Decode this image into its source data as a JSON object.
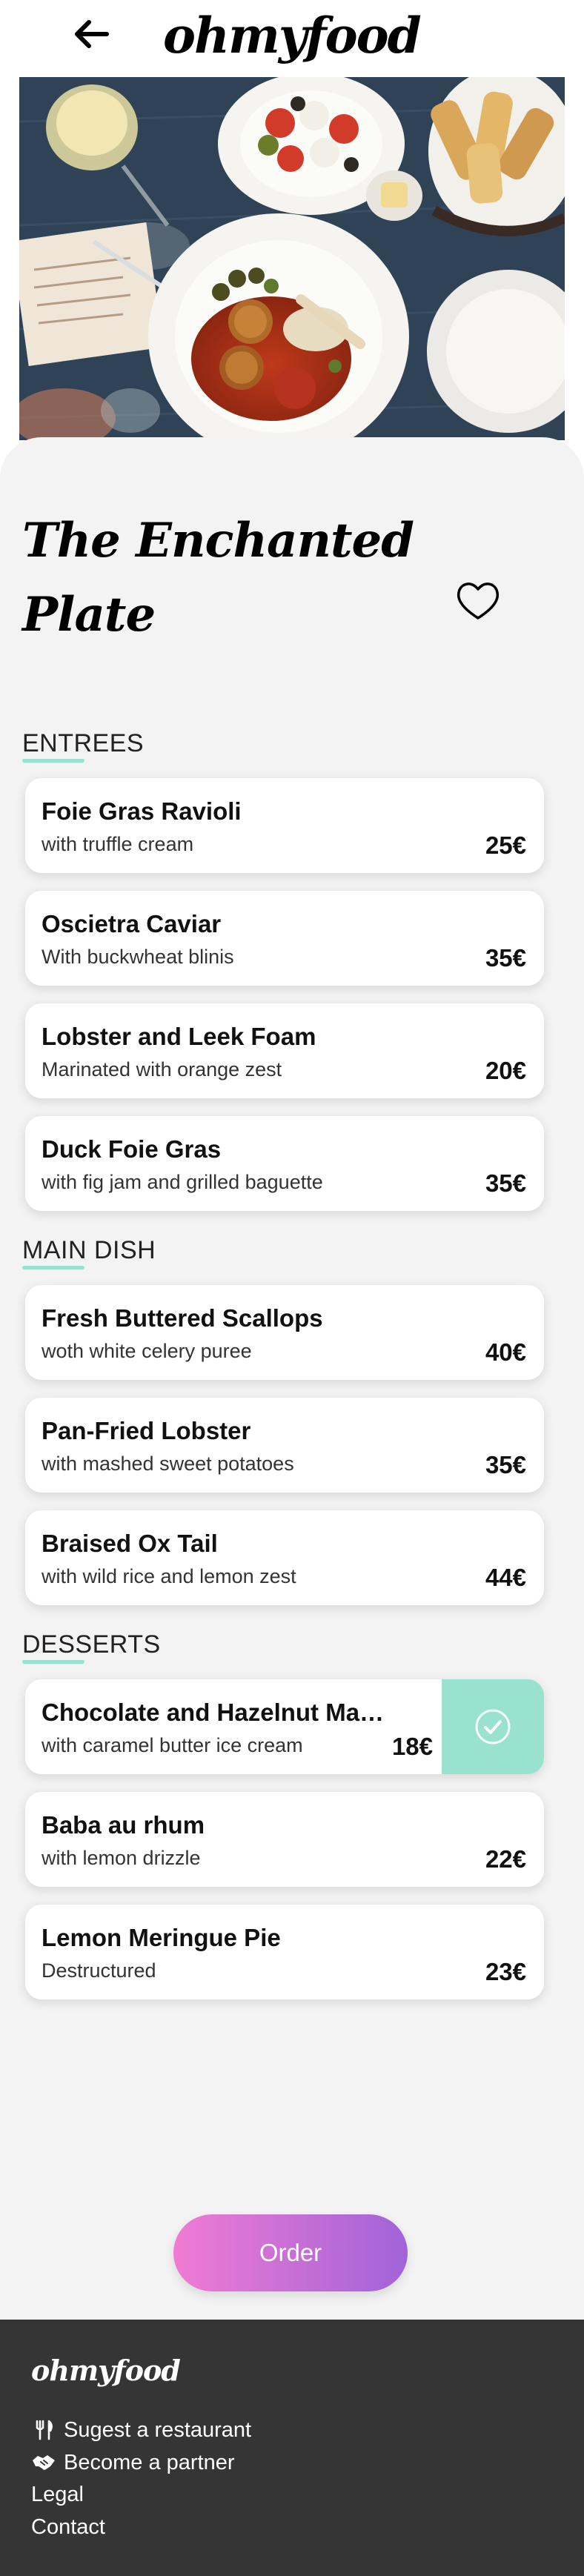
{
  "header": {
    "logo": "ohmyfood"
  },
  "restaurant": {
    "name": "The Enchanted Plate"
  },
  "sections": [
    {
      "title": "ENTREES",
      "dishes": [
        {
          "name": "Foie Gras Ravioli",
          "desc": "with truffle cream",
          "price": "25€"
        },
        {
          "name": "Oscietra Caviar",
          "desc": "With buckwheat blinis",
          "price": "35€"
        },
        {
          "name": "Lobster and Leek Foam",
          "desc": "Marinated with orange zest",
          "price": "20€"
        },
        {
          "name": "Duck Foie Gras",
          "desc": "with fig jam and grilled baguette",
          "price": "35€"
        }
      ]
    },
    {
      "title": "MAIN DISH",
      "dishes": [
        {
          "name": "Fresh Buttered Scallops",
          "desc": "woth white celery puree",
          "price": "40€"
        },
        {
          "name": "Pan-Fried Lobster",
          "desc": "with mashed sweet potatoes",
          "price": "35€"
        },
        {
          "name": "Braised Ox Tail",
          "desc": "with wild rice and lemon zest",
          "price": "44€"
        }
      ]
    },
    {
      "title": "DESSERTS",
      "dishes": [
        {
          "name": "Chocolate and Hazelnut Ma…",
          "desc": "with caramel butter ice cream",
          "price": "18€",
          "selected": true
        },
        {
          "name": "Baba au rhum",
          "desc": "with lemon drizzle",
          "price": "22€"
        },
        {
          "name": "Lemon Meringue Pie",
          "desc": "Destructured",
          "price": "23€"
        }
      ]
    }
  ],
  "order_button": "Order",
  "footer": {
    "logo": "ohmyfood",
    "links": [
      {
        "label": "Sugest a restaurant",
        "icon": "utensils-icon"
      },
      {
        "label": "Become a partner",
        "icon": "handshake-icon"
      },
      {
        "label": "Legal",
        "icon": ""
      },
      {
        "label": "Contact",
        "icon": ""
      }
    ]
  },
  "colors": {
    "accent": "#99e2d0",
    "background": "#f3f3f3",
    "footer": "#353535",
    "order_gradient_start": "#f07bd3",
    "order_gradient_end": "#a163d9"
  }
}
